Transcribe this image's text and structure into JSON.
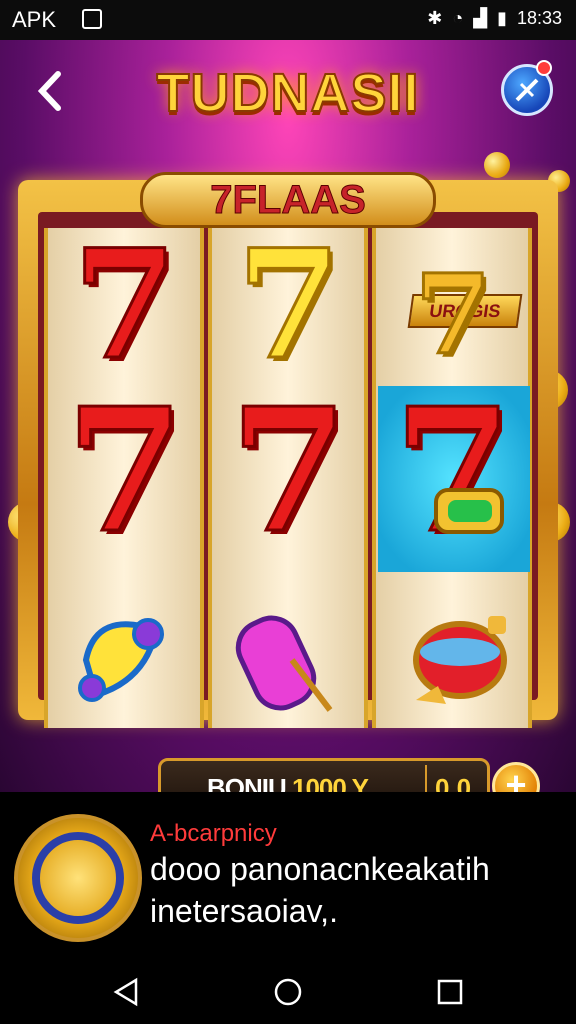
{
  "status_bar": {
    "left_text": "APK",
    "time": "18:33"
  },
  "game": {
    "title": "TUDNASII",
    "plaque": "7FLAAS",
    "reel3_label": "UROGIS",
    "bonus_label": "BONIU",
    "bonus_amount": "1000 Y",
    "credits": "0 0",
    "plus_symbol": "+",
    "symbols": [
      "red-seven",
      "yellow-seven",
      "gold-seven",
      "red-seven",
      "red-seven",
      "red-seven",
      "yellow-purple-gem",
      "purple-potion",
      "red-potion"
    ]
  },
  "ad": {
    "tag": "A-bcarpnicy",
    "text": "dooo panonacnkeakatih inetersaoiav,."
  },
  "colors": {
    "accent": "#ffd43b",
    "frame": "#d89a2b",
    "red": "#e81c1c",
    "background": "#a9219a"
  }
}
